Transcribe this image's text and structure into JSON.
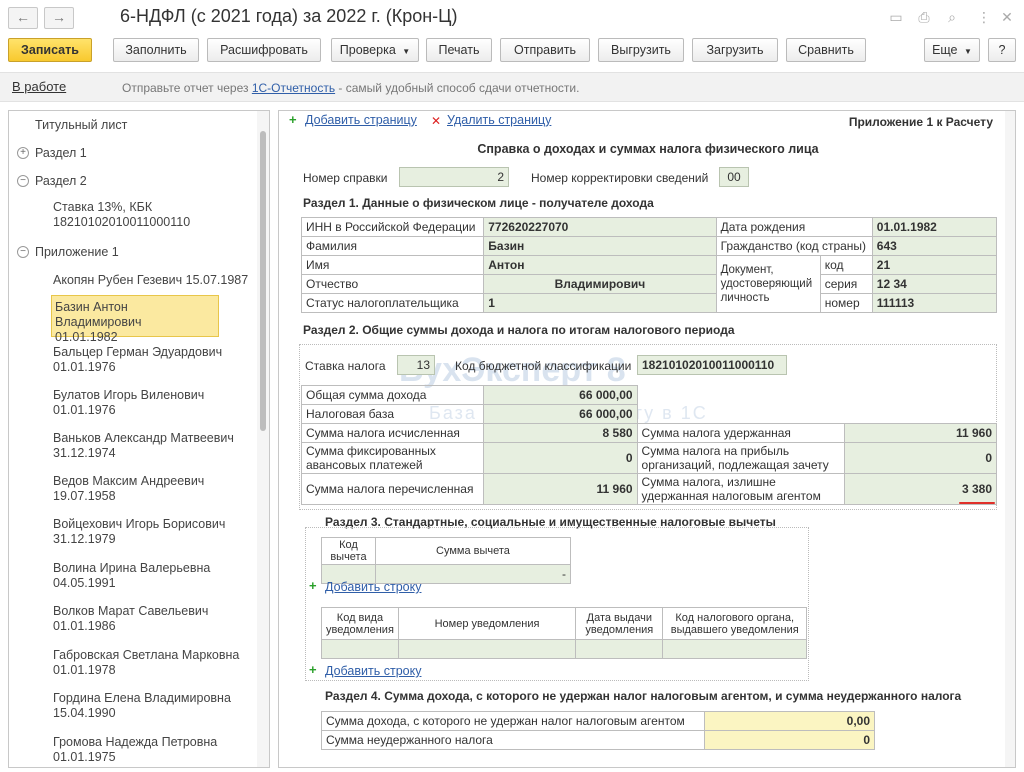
{
  "window": {
    "title": "6-НДФЛ (с 2021 года) за 2022 г. (Крон-Ц)",
    "nav_back": "←",
    "nav_forward": "→"
  },
  "toolbar": {
    "save": "Записать",
    "fill": "Заполнить",
    "decode": "Расшифровать",
    "check": "Проверка",
    "print": "Печать",
    "send": "Отправить",
    "export": "Выгрузить",
    "import": "Загрузить",
    "compare": "Сравнить",
    "more": "Еще",
    "help": "?"
  },
  "infobar": {
    "status": "В работе",
    "text_before": "Отправьте отчет через ",
    "link": "1С-Отчетность",
    "text_after": " - самый удобный способ сдачи отчетности."
  },
  "tree": {
    "title_page": "Титульный лист",
    "section1": "Раздел 1",
    "section2": "Раздел 2",
    "rate_item_l1": "Ставка 13%, КБК",
    "rate_item_l2": "18210102010011000110",
    "appendix1": "Приложение 1",
    "people": [
      {
        "name": "Акопян Рубен Гезевич 15.07.1987",
        "date": ""
      },
      {
        "name": "Базин Антон Владимирович",
        "date": "01.01.1982"
      },
      {
        "name": "Бальцер Герман Эдуардович",
        "date": "01.01.1976"
      },
      {
        "name": "Булатов Игорь Виленович",
        "date": "01.01.1976"
      },
      {
        "name": "Ваньков Александр Матвеевич",
        "date": "31.12.1974"
      },
      {
        "name": "Ведов Максим Андреевич",
        "date": "19.07.1958"
      },
      {
        "name": "Войцехович Игорь Борисович",
        "date": "31.12.1979"
      },
      {
        "name": "Волина Ирина Валерьевна",
        "date": "04.05.1991"
      },
      {
        "name": "Волков Марат Савельевич",
        "date": "01.01.1986"
      },
      {
        "name": "Габровская Светлана Марковна",
        "date": "01.01.1978"
      },
      {
        "name": "Гордина Елена Владимировна",
        "date": "15.04.1990"
      },
      {
        "name": "Громова Надежда Петровна",
        "date": "01.01.1975"
      }
    ]
  },
  "form": {
    "add_page": "Добавить страницу",
    "delete_page": "Удалить страницу",
    "appendix_label": "Приложение 1 к Расчету",
    "heading": "Справка о доходах и суммах налога физического лица",
    "cert_number_label": "Номер справки",
    "cert_number": "2",
    "correction_label": "Номер корректировки сведений",
    "correction": "00",
    "s1_title": "Раздел 1. Данные о физическом лице - получателе дохода",
    "s1": {
      "inn_label": "ИНН в Российской Федерации",
      "inn": "772620227070",
      "birth_label": "Дата рождения",
      "birth": "01.01.1982",
      "surname_label": "Фамилия",
      "surname": "Базин",
      "citizenship_label": "Гражданство (код страны)",
      "citizenship": "643",
      "name_label": "Имя",
      "name": "Антон",
      "doc_label": "Документ, удостоверяющий личность",
      "code_label": "код",
      "code": "21",
      "patronymic_label": "Отчество",
      "patronymic": "Владимирович",
      "series_label": "серия",
      "series": "12 34",
      "taxpayer_status_label": "Статус налогоплательщика",
      "taxpayer_status": "1",
      "number_label": "номер",
      "number": "111113"
    },
    "s2_title": "Раздел 2. Общие суммы дохода и налога по итогам налогового периода",
    "s2": {
      "rate_label": "Ставка налога",
      "rate": "13",
      "kbk_label": "Код бюджетной классификации",
      "kbk": "18210102010011000110",
      "total_income_label": "Общая сумма дохода",
      "total_income": "66 000,00",
      "tax_base_label": "Налоговая база",
      "tax_base": "66 000,00",
      "tax_calc_label": "Сумма налога исчисленная",
      "tax_calc": "8 580",
      "tax_withheld_label": "Сумма налога удержанная",
      "tax_withheld": "11 960",
      "fixed_adv_label": "Сумма фиксированных авансовых платежей",
      "fixed_adv": "0",
      "profit_tax_label": "Сумма налога на прибыль организаций, подлежащая зачету",
      "profit_tax": "0",
      "transferred_label": "Сумма налога перечисленная",
      "transferred": "11 960",
      "excess_label": "Сумма налога, излишне удержанная налоговым агентом",
      "excess": "3 380"
    },
    "s3_title": "Раздел 3. Стандартные, социальные и имущественные налоговые вычеты",
    "s3": {
      "code_col": "Код вычета",
      "amount_col": "Сумма вычета",
      "amount_value": "-",
      "add_row": "Добавить строку",
      "notif_type_col": "Код вида уведомления",
      "notif_number_col": "Номер уведомления",
      "notif_date_col": "Дата выдачи уведомления",
      "notif_authority_col": "Код налогового органа, выдавшего уведомления",
      "add_row2": "Добавить строку"
    },
    "s4_title": "Раздел 4. Сумма дохода, с которого не удержан налог налоговым агентом, и сумма неудержанного налога",
    "s4": {
      "income_label": "Сумма дохода, с которого не удержан налог налоговым агентом",
      "income": "0,00",
      "unwithheld_label": "Сумма неудержанного налога",
      "unwithheld": "0"
    },
    "watermark": "БухЭксперт 8",
    "watermark_sub": "База ответов по учету в 1С"
  },
  "colors": {
    "primary_button": "#f8c92e",
    "field_bg": "#e7efe0",
    "selected_row": "#fbe9a0",
    "link": "#2f5ea8",
    "highlight_underline": "#e0302a"
  }
}
